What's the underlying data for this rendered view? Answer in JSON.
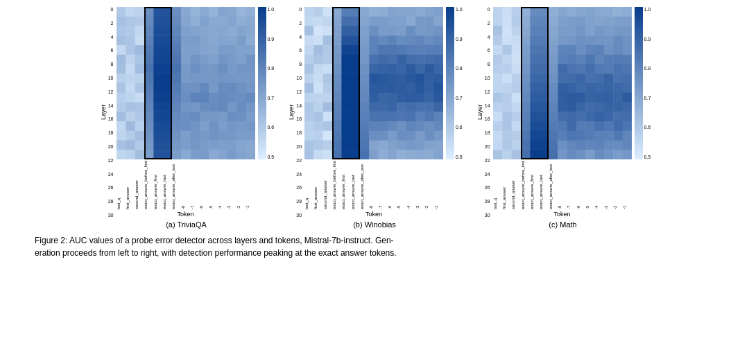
{
  "charts": [
    {
      "id": "triviaqa",
      "caption": "(a) TriviaQA",
      "x_label": "Token",
      "y_label": "Layer",
      "y_ticks": [
        "0",
        "2",
        "4",
        "6",
        "8",
        "10",
        "12",
        "14",
        "16",
        "18",
        "20",
        "22",
        "24",
        "26",
        "28",
        "30"
      ],
      "y_ticks_display": [
        "0",
        "2",
        "4",
        "6",
        "8",
        "10",
        "12",
        "14",
        "16",
        "18",
        "20",
        "22",
        "24",
        "26",
        "28",
        "30"
      ],
      "x_ticks_named": [
        "last_q",
        "first_answer",
        "second_answer",
        "exact_answer_before_first",
        "exact_answer_first",
        "exact_answer_last",
        "exact_answer_after_last"
      ],
      "x_ticks_num": [
        "-8",
        "-7",
        "-6",
        "-5",
        "-4",
        "-3",
        "-2",
        "-1"
      ],
      "colorbar_ticks": [
        "1.0",
        "0.9",
        "0.8",
        "0.7",
        "0.6",
        "0.5"
      ],
      "highlight": {
        "x_start_frac": 0.38,
        "x_end_frac": 0.58,
        "y_start_frac": 0,
        "y_end_frac": 1
      }
    },
    {
      "id": "winobias",
      "caption": "(b) Winobias",
      "x_label": "Token",
      "y_label": "Layer",
      "colorbar_ticks": [
        "1.0",
        "0.9",
        "0.8",
        "0.7",
        "0.6",
        "0.5"
      ],
      "highlight": {
        "x_start_frac": 0.38,
        "x_end_frac": 0.58,
        "y_start_frac": 0,
        "y_end_frac": 1
      }
    },
    {
      "id": "math",
      "caption": "(c) Math",
      "x_label": "Token",
      "y_label": "Layer",
      "colorbar_ticks": [
        "1.0",
        "0.9",
        "0.8",
        "0.7",
        "0.6",
        "0.5"
      ],
      "highlight": {
        "x_start_frac": 0.38,
        "x_end_frac": 0.58,
        "y_start_frac": 0,
        "y_end_frac": 1
      }
    }
  ],
  "figure_caption_line1": "Figure 2: AUC values of a probe error detector across layers and tokens, Mistral-7b-instruct. Gen-",
  "figure_caption_line2": "eration proceeds from left to right, with detection performance peaking at the exact answer tokens."
}
